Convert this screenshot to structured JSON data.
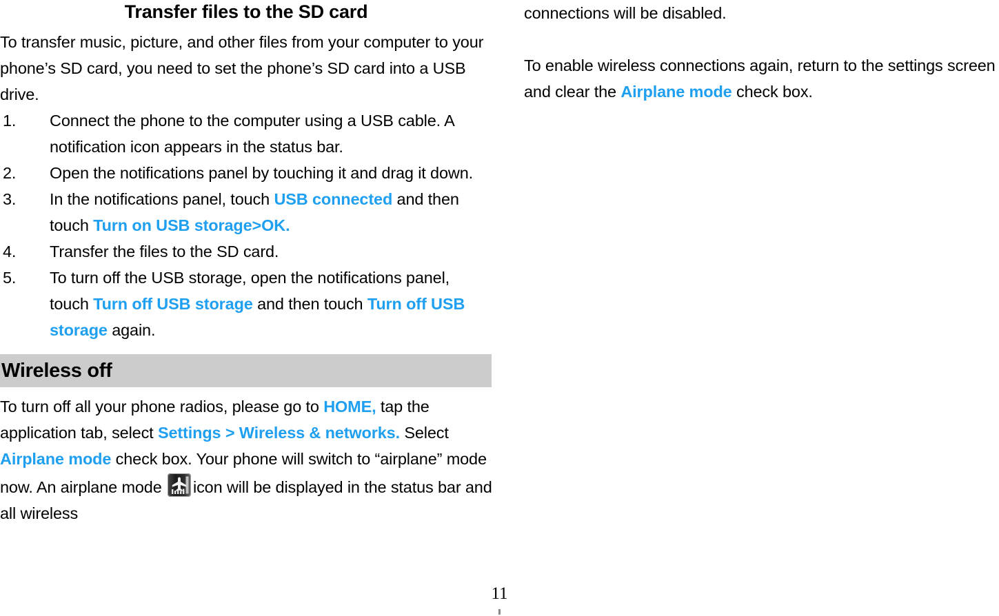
{
  "colors": {
    "link_blue": "#1e9ff0",
    "section_bar_bg": "#cccccc",
    "text": "#000000",
    "page_bg": "#ffffff"
  },
  "left_column": {
    "title": "Transfer files to the SD card",
    "intro_paragraph": "To transfer music, picture, and other files from your computer to your phone’s SD card, you need to set the phone’s SD card into a USB drive.",
    "steps": [
      {
        "number": "1.",
        "runs": [
          {
            "text": "Connect the phone to the computer using a USB cable. A notification icon appears in the status bar.",
            "style": "normal"
          }
        ]
      },
      {
        "number": "2.",
        "runs": [
          {
            "text": "Open the notifications panel by touching it and drag it down.",
            "style": "normal"
          }
        ]
      },
      {
        "number": "3.",
        "runs": [
          {
            "text": "In the notifications panel, touch ",
            "style": "normal"
          },
          {
            "text": "USB connected",
            "style": "highlight"
          },
          {
            "text": " and then touch ",
            "style": "normal"
          },
          {
            "text": "Turn on USB storage>OK.",
            "style": "highlight"
          }
        ]
      },
      {
        "number": "4.",
        "runs": [
          {
            "text": "Transfer the files to the SD card.",
            "style": "normal"
          }
        ]
      },
      {
        "number": "5.",
        "runs": [
          {
            "text": "To turn off the USB storage, open the notifications panel, touch ",
            "style": "normal"
          },
          {
            "text": "Turn off USB storage",
            "style": "highlight"
          },
          {
            "text": " and then touch ",
            "style": "normal"
          },
          {
            "text": "Turn off USB storage",
            "style": "highlight"
          },
          {
            "text": " again.",
            "style": "normal"
          }
        ]
      }
    ],
    "section_heading": "Wireless off",
    "wireless_paragraph_runs": [
      {
        "text": "To turn off all your phone radios, please go to ",
        "style": "normal"
      },
      {
        "text": "HOME,",
        "style": "highlight"
      },
      {
        "text": " tap the application tab, select ",
        "style": "normal"
      },
      {
        "text": "Settings > Wireless & networks.",
        "style": "highlight"
      },
      {
        "text": " Select ",
        "style": "normal"
      },
      {
        "text": "Airplane mode",
        "style": "highlight"
      },
      {
        "text": " check box. Your phone will switch to “airplane” mode now. An airplane mode ",
        "style": "normal"
      },
      {
        "text": "",
        "style": "icon",
        "icon": "airplane-mode-icon"
      },
      {
        "text": "icon will be displayed in the status bar and all wireless",
        "style": "normal"
      }
    ]
  },
  "right_column": {
    "continuation_line": "connections will be disabled.",
    "paragraph_runs": [
      {
        "text": "To enable wireless connections again, return to the settings screen and clear the ",
        "style": "normal"
      },
      {
        "text": "Airplane mode",
        "style": "highlight"
      },
      {
        "text": " check box.",
        "style": "normal"
      }
    ]
  },
  "footer": {
    "page_number": "11"
  }
}
